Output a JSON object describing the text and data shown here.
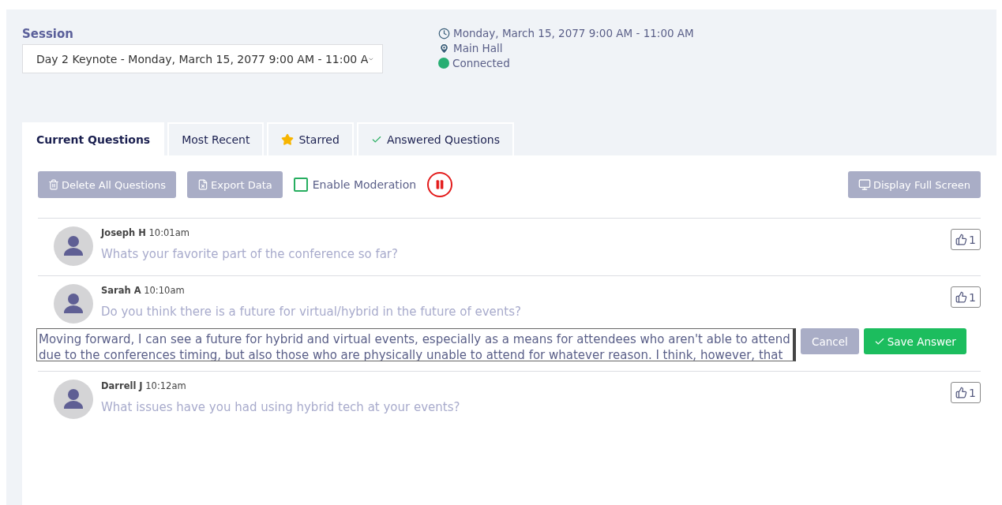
{
  "session": {
    "label": "Session",
    "value": "Day 2 Keynote - Monday, March 15, 2077 9:00 AM - 11:00 A"
  },
  "info": {
    "time": "Monday, March 15, 2077 9:00 AM - 11:00 AM",
    "location": "Main Hall",
    "status": "Connected",
    "connected": true
  },
  "tabs": [
    {
      "label": "Current Questions",
      "selected": true,
      "kind": "plain"
    },
    {
      "label": "Most Recent",
      "selected": false,
      "kind": "plain"
    },
    {
      "label": "Starred",
      "selected": false,
      "kind": "starred"
    },
    {
      "label": "Answered Questions",
      "selected": false,
      "kind": "answered"
    }
  ],
  "toolbar": {
    "delete": "Delete All Questions",
    "export": "Export Data",
    "moderation": {
      "label": "Enable Moderation",
      "checked": false
    },
    "paused": false,
    "fullscreen": "Display Full Screen"
  },
  "questions": [
    {
      "name": "Joseph H",
      "time": "10:01am",
      "text": "Whats your favorite part of the conference so far?",
      "likes": "1"
    },
    {
      "name": "Sarah A",
      "time": "10:10am",
      "text": "Do you think there is a future for virtual/hybrid in the future of events?",
      "likes": "1",
      "answer": {
        "value": "Moving forward, I can see a future for hybrid and virtual events, especially as a means for attendees who aren't able to attend due to the conferences timing, but also those who are physically unable to attend for whatever reason. I think, however, that",
        "cancel": "Cancel",
        "save": "Save Answer"
      }
    },
    {
      "name": "Darrell J",
      "time": "10:12am",
      "text": "What issues have you had using hybrid tech at your events?",
      "likes": "1"
    }
  ]
}
